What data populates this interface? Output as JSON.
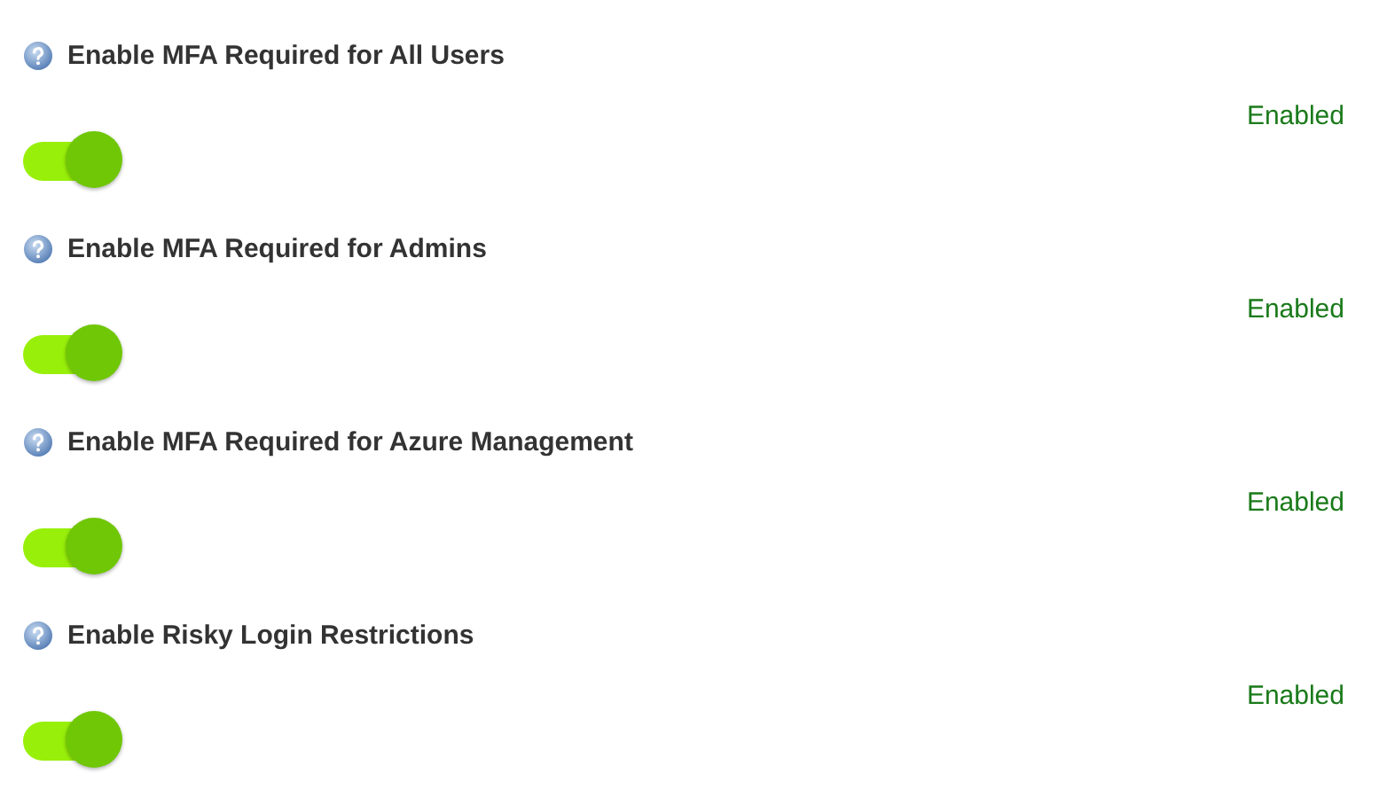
{
  "settings": [
    {
      "label": "Enable MFA Required for All Users",
      "status": "Enabled",
      "on": true
    },
    {
      "label": "Enable MFA Required for Admins",
      "status": "Enabled",
      "on": true
    },
    {
      "label": "Enable MFA Required for Azure Management",
      "status": "Enabled",
      "on": true
    },
    {
      "label": "Enable Risky Login Restrictions",
      "status": "Enabled",
      "on": true
    }
  ]
}
